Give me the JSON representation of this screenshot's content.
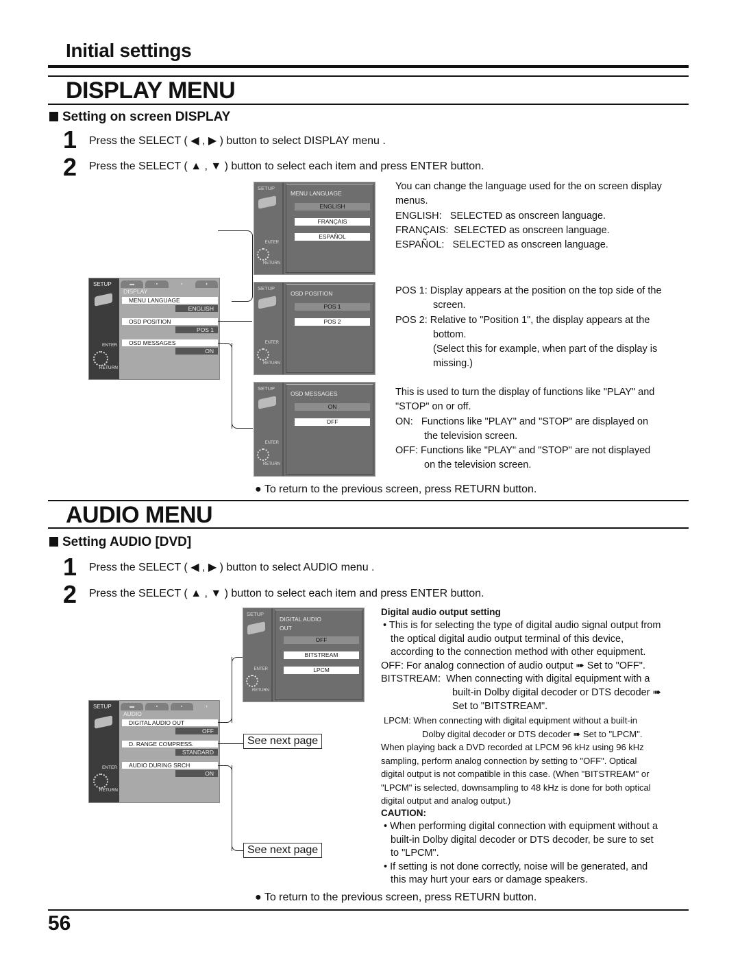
{
  "page": {
    "section_title": "Initial settings",
    "page_number": "56"
  },
  "display_menu": {
    "title": "DISPLAY MENU",
    "subheading": "Setting on screen DISPLAY",
    "steps": [
      {
        "num": "1",
        "text": "Press the SELECT ( ◀ , ▶ ) button to select DISPLAY menu ."
      },
      {
        "num": "2",
        "text": "Press the SELECT ( ▲ , ▼ ) button to select each item and press ENTER button."
      }
    ],
    "osd_main": {
      "side_label": "SETUP",
      "enter_label": "ENTER",
      "return_label": "RETURN",
      "tabs": [
        "disc-icon",
        "picture-icon",
        "display-icon",
        "speaker-icon"
      ],
      "active_tab": 2,
      "category": "DISPLAY",
      "items": [
        {
          "label": "MENU LANGUAGE",
          "value": "ENGLISH"
        },
        {
          "label": "OSD POSITION",
          "value": "POS  1"
        },
        {
          "label": "OSD MESSAGES",
          "value": "ON"
        }
      ]
    },
    "submenus": [
      {
        "title": "MENU LANGUAGE",
        "options": [
          "ENGLISH",
          "FRANÇAIS",
          "ESPAÑOL"
        ],
        "selected": 0,
        "description": [
          "You can change the language used for the on screen display menus.",
          "ENGLISH:   SELECTED as onscreen language.",
          "FRANÇAIS:  SELECTED as onscreen language.",
          "ESPAÑOL:   SELECTED as onscreen language."
        ]
      },
      {
        "title": "OSD POSITION",
        "options": [
          "POS 1",
          "POS 2"
        ],
        "selected": 0,
        "description": [
          "POS 1: Display appears at the position on the top side of the",
          "screen.",
          "POS 2: Relative to \"Position 1\", the display appears at the",
          "bottom.",
          "(Select this for example, when part of the display is",
          "missing.)"
        ]
      },
      {
        "title": "OSD MESSAGES",
        "options": [
          "ON",
          "OFF"
        ],
        "selected": 0,
        "description": [
          "This is used to turn the display of functions like \"PLAY\" and",
          "\"STOP\" on or off.",
          "ON:   Functions like \"PLAY\" and \"STOP\" are displayed on",
          "the television screen.",
          "OFF: Functions like \"PLAY\" and \"STOP\" are not displayed",
          "on the television screen."
        ]
      }
    ],
    "return_note": "● To return to the previous screen, press RETURN button."
  },
  "audio_menu": {
    "title": "AUDIO MENU",
    "subheading": "Setting AUDIO [DVD]",
    "steps": [
      {
        "num": "1",
        "text": "Press the SELECT ( ◀ , ▶ ) button to select AUDIO menu ."
      },
      {
        "num": "2",
        "text": "Press the SELECT ( ▲ , ▼ ) button to select each item and press ENTER button."
      }
    ],
    "osd_main": {
      "side_label": "SETUP",
      "enter_label": "ENTER",
      "return_label": "RETURN",
      "tabs": [
        "disc-icon",
        "picture-icon",
        "display-icon",
        "speaker-icon"
      ],
      "active_tab": 3,
      "category": "AUDIO",
      "items": [
        {
          "label": "DIGITAL AUDIO OUT",
          "value": "OFF"
        },
        {
          "label": "D. RANGE COMPRESS.",
          "value": "STANDARD"
        },
        {
          "label": "AUDIO DURING SRCH",
          "value": "ON"
        }
      ]
    },
    "submenu": {
      "title_line1": "DIGITAL AUDIO",
      "title_line2": "OUT",
      "options": [
        "OFF",
        "BITSTREAM",
        "LPCM"
      ],
      "selected": 0
    },
    "see_next_page": "See next page",
    "description": {
      "heading": "Digital audio output setting",
      "bullet": [
        "• This is for selecting the type of digital audio signal output from",
        "the optical digital audio output terminal of this device,",
        "according to the connection method with other equipment."
      ],
      "off_line": "OFF: For analog connection of audio output ➠  Set to \"OFF\".",
      "bitstream": [
        "BITSTREAM:  When connecting with digital equipment with a",
        "built-in Dolby digital decoder or DTS decoder ➠",
        "Set to \"BITSTREAM\"."
      ],
      "lpcm": [
        "LPCM: When connecting with digital equipment without a built-in",
        "Dolby digital decoder or DTS decoder ➠ Set to \"LPCM\"."
      ],
      "note": [
        "When playing back a DVD recorded at LPCM 96 kHz using 96 kHz",
        "sampling, perform analog connection by setting to \"OFF\". Optical",
        "digital output is not compatible in this case. (When \"BITSTREAM\" or",
        "\"LPCM\" is selected, downsampling to 48 kHz is done for both optical",
        "digital output and analog output.)"
      ],
      "caution_heading": "CAUTION:",
      "caution": [
        "• When performing digital connection with equipment without a",
        "built-in Dolby digital decoder or DTS decoder, be sure to set",
        "to \"LPCM\".",
        "• If setting is not done correctly, noise will be generated, and",
        "this may hurt your ears or damage speakers."
      ]
    },
    "return_note": "● To return to the previous screen, press RETURN button."
  }
}
